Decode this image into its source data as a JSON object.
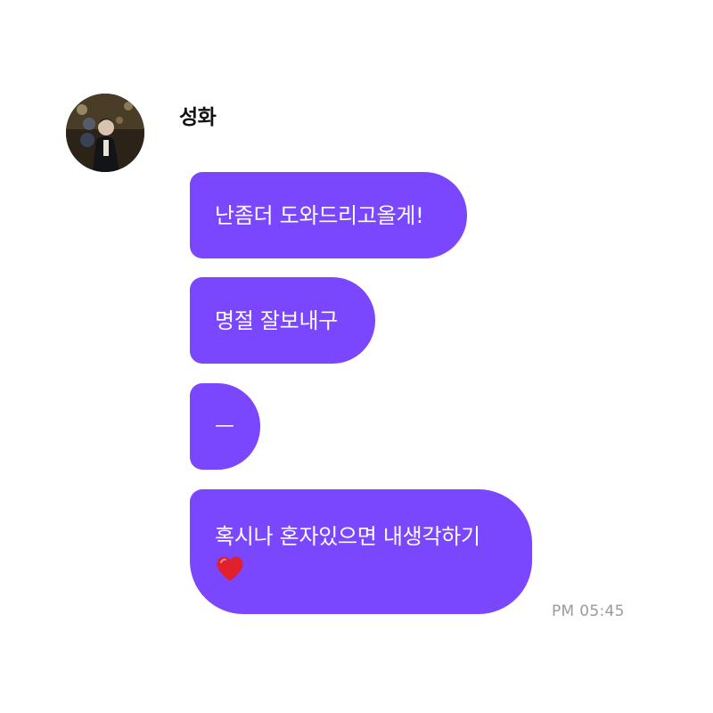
{
  "chat": {
    "sender": {
      "name": "성화",
      "avatar_icon": "profile-photo"
    },
    "accent_color": "#7a47ff",
    "messages": [
      {
        "text": "난좀더 도와드리고올게!"
      },
      {
        "text": "명절 잘보내구"
      },
      {
        "text": "ㅡ"
      },
      {
        "text": "혹시나 혼자있으면 내생각하기",
        "emoji_icon": "red-heart-emoji"
      }
    ],
    "timestamp": "PM 05:45"
  }
}
